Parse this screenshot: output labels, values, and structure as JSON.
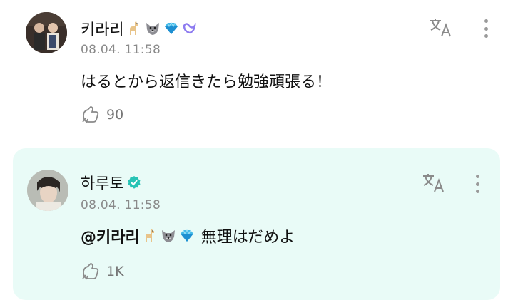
{
  "posts": [
    {
      "author": "키라리",
      "author_emojis": [
        "llama-emoji",
        "wolf-emoji",
        "gem-emoji",
        "purple-heart-loop-emoji"
      ],
      "timestamp": "08.04. 11:58",
      "text": "はるとから返信きたら勉強頑張る！",
      "likes": "90",
      "icons": {
        "translate": "translate-icon",
        "more": "more-vertical-icon",
        "like": "like-paw-icon"
      }
    },
    {
      "author": "하루토",
      "verified": true,
      "timestamp": "08.04. 11:58",
      "mention": "@키라리",
      "mention_emojis": [
        "llama-emoji",
        "wolf-emoji",
        "gem-emoji"
      ],
      "text": "無理はだめよ",
      "likes": "1K",
      "highlighted": true,
      "background_color": "#e9fbf7",
      "icons": {
        "translate": "translate-icon",
        "more": "more-vertical-icon",
        "like": "like-paw-icon"
      }
    }
  ],
  "colors": {
    "verified": "#27c3b5",
    "timestamp": "#8a8a8a",
    "icon": "#8a8a8a"
  }
}
